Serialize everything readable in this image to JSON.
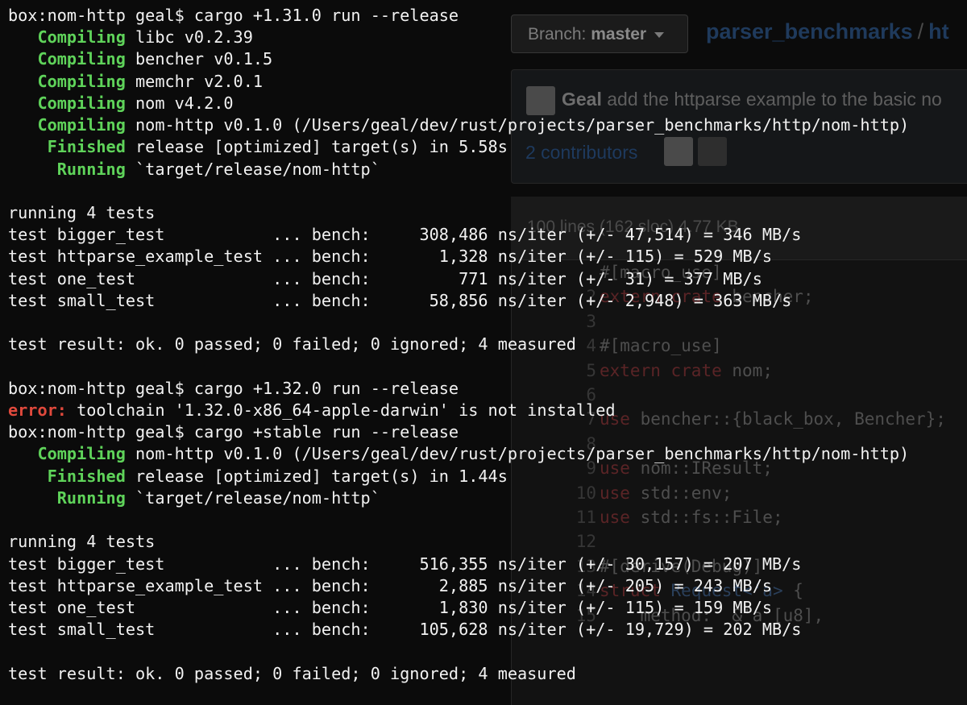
{
  "github": {
    "branch_label": "Branch:",
    "branch_name": "master",
    "repo_name": "parser_benchmarks",
    "path_separator": "/",
    "path_next": "ht",
    "commit_author": "Geal",
    "commit_message": "add the httparse example to the basic no",
    "contributors": "2 contributors",
    "file_info": "100 lines (162 sloc)   4.77 KB",
    "code_lines": [
      {
        "num": "",
        "text": "#[macro_use]"
      },
      {
        "num": "2",
        "text": "extern crate bencher;"
      },
      {
        "num": "3",
        "text": ""
      },
      {
        "num": "4",
        "text": "#[macro_use]"
      },
      {
        "num": "5",
        "text": "extern crate nom;"
      },
      {
        "num": "6",
        "text": ""
      },
      {
        "num": "7",
        "text": "use bencher::{black_box, Bencher};"
      },
      {
        "num": "8",
        "text": ""
      },
      {
        "num": "9",
        "text": "use nom::IResult;"
      },
      {
        "num": "10",
        "text": "use std::env;"
      },
      {
        "num": "11",
        "text": "use std::fs::File;"
      },
      {
        "num": "12",
        "text": ""
      },
      {
        "num": "13",
        "text": "#[derive(Debug)]"
      },
      {
        "num": "14",
        "text": "struct Request<'a> {"
      },
      {
        "num": "15",
        "text": "    method:  &'a [u8],"
      }
    ]
  },
  "terminal": {
    "lines": [
      {
        "plain": "box:nom-http geal$ cargo +1.31.0 run --release"
      },
      {
        "pad": "   ",
        "tag": "Compiling",
        "tag_color": "green",
        "rest": " libc v0.2.39"
      },
      {
        "pad": "   ",
        "tag": "Compiling",
        "tag_color": "green",
        "rest": " bencher v0.1.5"
      },
      {
        "pad": "   ",
        "tag": "Compiling",
        "tag_color": "green",
        "rest": " memchr v2.0.1"
      },
      {
        "pad": "   ",
        "tag": "Compiling",
        "tag_color": "green",
        "rest": " nom v4.2.0"
      },
      {
        "pad": "   ",
        "tag": "Compiling",
        "tag_color": "green",
        "rest": " nom-http v0.1.0 (/Users/geal/dev/rust/projects/parser_benchmarks/http/nom-http)"
      },
      {
        "pad": "    ",
        "tag": "Finished",
        "tag_color": "green",
        "rest": " release [optimized] target(s) in 5.58s"
      },
      {
        "pad": "     ",
        "tag": "Running",
        "tag_color": "green",
        "rest": " `target/release/nom-http`"
      },
      {
        "plain": ""
      },
      {
        "plain": "running 4 tests"
      },
      {
        "plain": "test bigger_test           ... bench:     308,486 ns/iter (+/- 47,514) = 346 MB/s"
      },
      {
        "plain": "test httparse_example_test ... bench:       1,328 ns/iter (+/- 115) = 529 MB/s"
      },
      {
        "plain": "test one_test              ... bench:         771 ns/iter (+/- 31) = 377 MB/s"
      },
      {
        "plain": "test small_test            ... bench:      58,856 ns/iter (+/- 2,948) = 363 MB/s"
      },
      {
        "plain": ""
      },
      {
        "plain": "test result: ok. 0 passed; 0 failed; 0 ignored; 4 measured"
      },
      {
        "plain": ""
      },
      {
        "plain": "box:nom-http geal$ cargo +1.32.0 run --release"
      },
      {
        "pad": "",
        "tag": "error:",
        "tag_color": "red",
        "rest": " toolchain '1.32.0-x86_64-apple-darwin' is not installed"
      },
      {
        "plain": "box:nom-http geal$ cargo +stable run --release"
      },
      {
        "pad": "   ",
        "tag": "Compiling",
        "tag_color": "green",
        "rest": " nom-http v0.1.0 (/Users/geal/dev/rust/projects/parser_benchmarks/http/nom-http)"
      },
      {
        "pad": "    ",
        "tag": "Finished",
        "tag_color": "green",
        "rest": " release [optimized] target(s) in 1.44s"
      },
      {
        "pad": "     ",
        "tag": "Running",
        "tag_color": "green",
        "rest": " `target/release/nom-http`"
      },
      {
        "plain": ""
      },
      {
        "plain": "running 4 tests"
      },
      {
        "plain": "test bigger_test           ... bench:     516,355 ns/iter (+/- 30,157) = 207 MB/s"
      },
      {
        "plain": "test httparse_example_test ... bench:       2,885 ns/iter (+/- 205) = 243 MB/s"
      },
      {
        "plain": "test one_test              ... bench:       1,830 ns/iter (+/- 115) = 159 MB/s"
      },
      {
        "plain": "test small_test            ... bench:     105,628 ns/iter (+/- 19,729) = 202 MB/s"
      },
      {
        "plain": ""
      },
      {
        "plain": "test result: ok. 0 passed; 0 failed; 0 ignored; 4 measured"
      }
    ]
  }
}
